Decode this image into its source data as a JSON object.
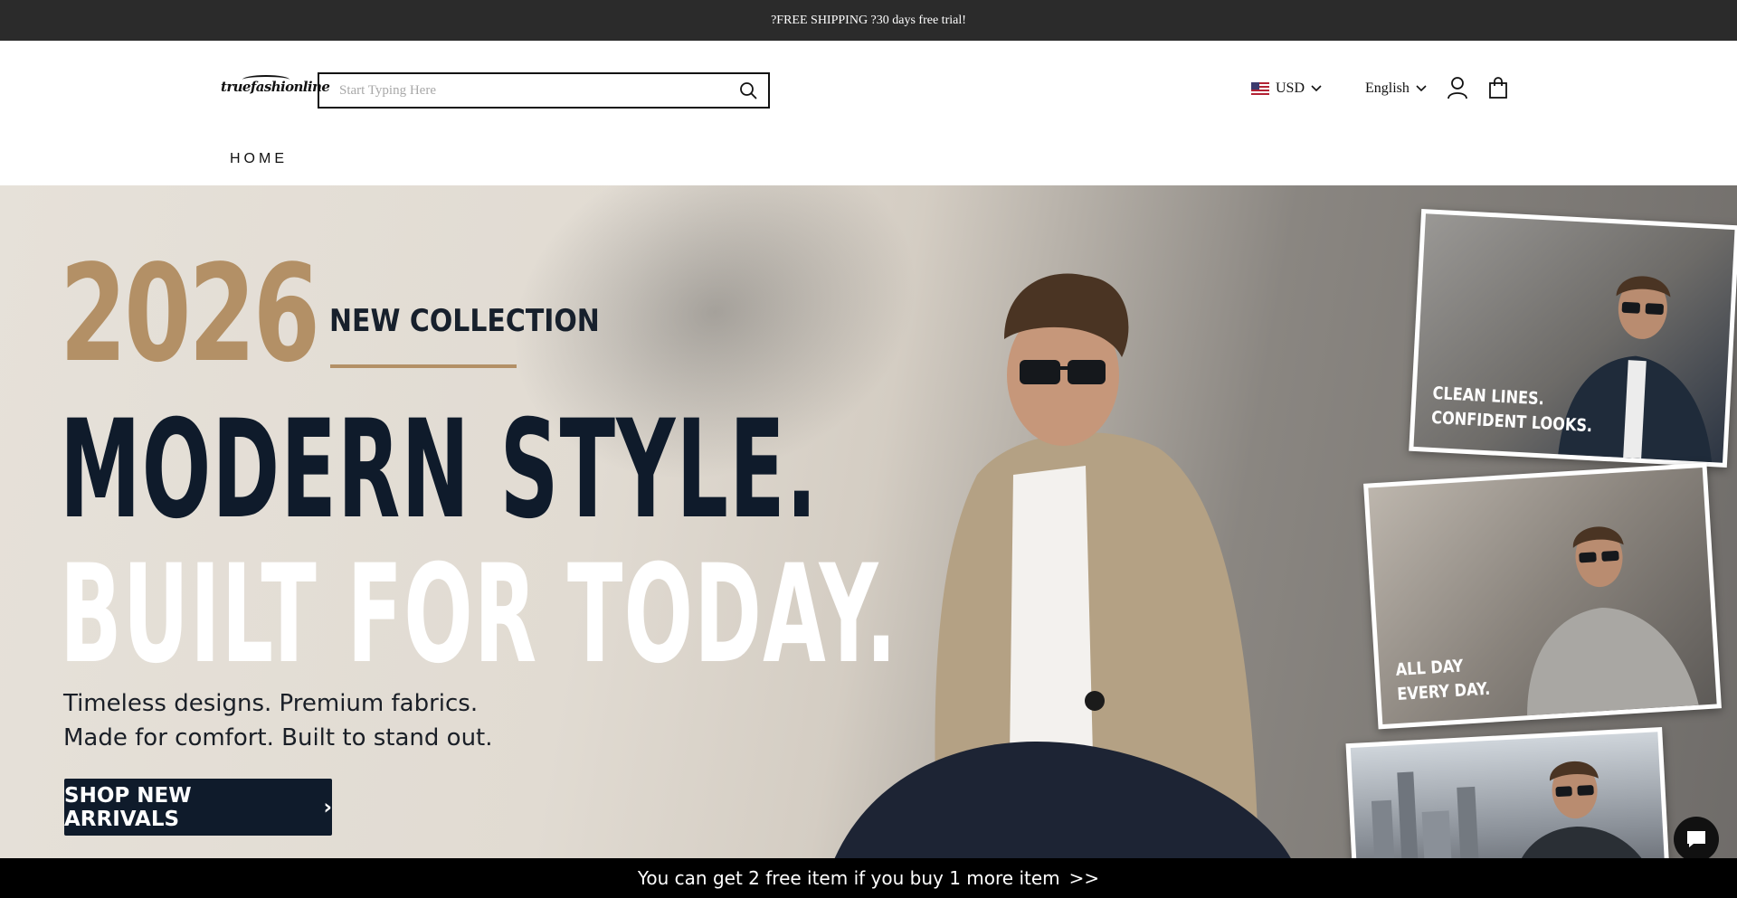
{
  "announcement": {
    "text": "?FREE SHIPPING ?30 days free trial!"
  },
  "header": {
    "logo_text": "truefashionline",
    "search": {
      "placeholder": "Start Typing Here",
      "value": ""
    },
    "currency": {
      "flag": "us-flag-icon",
      "label": "USD"
    },
    "language": {
      "label": "English"
    },
    "icons": [
      "search-icon",
      "chevron-down-icon",
      "account-icon",
      "cart-icon"
    ]
  },
  "nav": {
    "items": [
      {
        "label": "HOME"
      }
    ]
  },
  "hero": {
    "year": "2026",
    "subtitle": "NEW COLLECTION",
    "headline_1": "MODERN STYLE.",
    "headline_2": "BUILT FOR TODAY.",
    "tagline_1": "Timeless designs. Premium fabrics.",
    "tagline_2": "Made for comfort. Built to stand out.",
    "cta_label": "SHOP NEW ARRIVALS",
    "cta_arrow": "›",
    "panels": [
      {
        "line1": "CLEAN LINES.",
        "line2": "CONFIDENT LOOKS."
      },
      {
        "line1": "ALL DAY",
        "line2": "EVERY DAY."
      }
    ],
    "colors": {
      "accent_gold": "#b39066",
      "navy": "#0f1b2b"
    }
  },
  "chat": {
    "icon": "chat-bubble-icon"
  },
  "promo_bar": {
    "text": "You can get 2 free item if you buy 1 more item",
    "arrow": ">>"
  }
}
